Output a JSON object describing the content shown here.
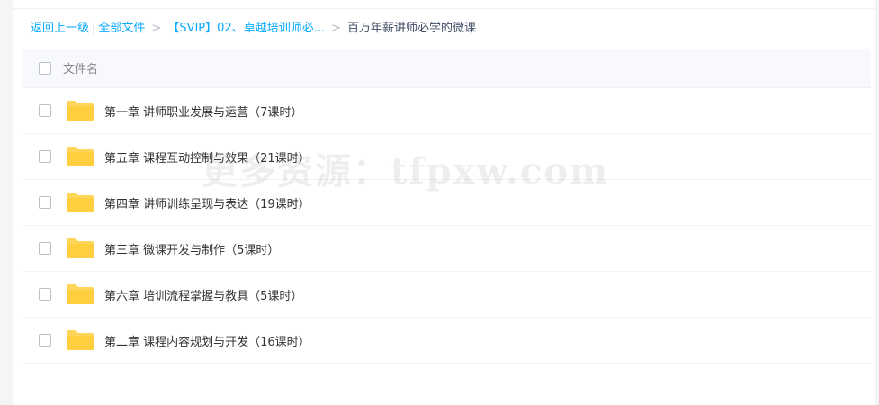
{
  "breadcrumb": {
    "back": "返回上一级",
    "all_files": "全部文件",
    "parent_folder": "【SVIP】02、卓越培训师必...",
    "current": "百万年薪讲师必学的微课",
    "separator": ">",
    "divider": "|"
  },
  "list_header": {
    "column_name": "文件名"
  },
  "files": [
    {
      "name": "第一章 讲师职业发展与运营（7课时）",
      "type": "folder"
    },
    {
      "name": "第五章 课程互动控制与效果（21课时）",
      "type": "folder"
    },
    {
      "name": "第四章 讲师训练呈现与表达（19课时）",
      "type": "folder"
    },
    {
      "name": "第三章 微课开发与制作（5课时）",
      "type": "folder"
    },
    {
      "name": "第六章 培训流程掌握与教具（5课时）",
      "type": "folder"
    },
    {
      "name": "第二章 课程内容规划与开发（16课时）",
      "type": "folder"
    }
  ],
  "watermark": "更多资源：tfpxw.com",
  "colors": {
    "link": "#09aaff",
    "folder": "#ffd659",
    "header_bg": "#f7f9fc"
  }
}
